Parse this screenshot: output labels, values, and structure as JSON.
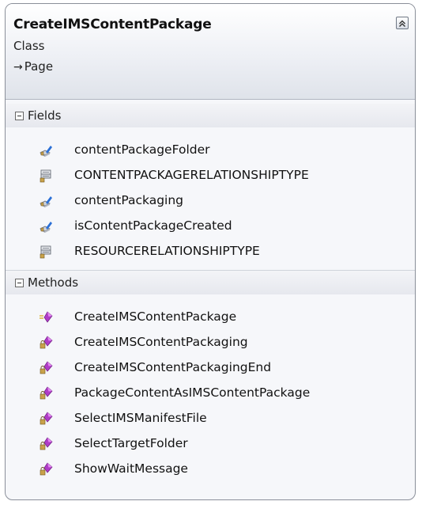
{
  "class": {
    "name": "CreateIMSContentPackage",
    "stereotype": "Class",
    "base_arrow": "→",
    "base": "Page"
  },
  "fields_section": {
    "label": "Fields",
    "items": [
      {
        "label": "contentPackageFolder",
        "icon": "private-field-icon"
      },
      {
        "label": "CONTENTPACKAGERELATIONSHIPTYPE",
        "icon": "constant-field-icon"
      },
      {
        "label": "contentPackaging",
        "icon": "private-field-icon"
      },
      {
        "label": "isContentPackageCreated",
        "icon": "private-field-icon"
      },
      {
        "label": "RESOURCERELATIONSHIPTYPE",
        "icon": "constant-field-icon"
      }
    ]
  },
  "methods_section": {
    "label": "Methods",
    "items": [
      {
        "label": "CreateIMSContentPackage",
        "icon": "public-method-icon"
      },
      {
        "label": "CreateIMSContentPackaging",
        "icon": "private-method-icon"
      },
      {
        "label": "CreateIMSContentPackagingEnd",
        "icon": "private-method-icon"
      },
      {
        "label": "PackageContentAsIMSContentPackage",
        "icon": "private-method-icon"
      },
      {
        "label": "SelectIMSManifestFile",
        "icon": "private-method-icon"
      },
      {
        "label": "SelectTargetFolder",
        "icon": "private-method-icon"
      },
      {
        "label": "ShowWaitMessage",
        "icon": "private-method-icon"
      }
    ]
  },
  "colors": {
    "method_icon": "#b03cc8",
    "field_icon": "#2a6fd6",
    "border": "#8a8f99"
  }
}
